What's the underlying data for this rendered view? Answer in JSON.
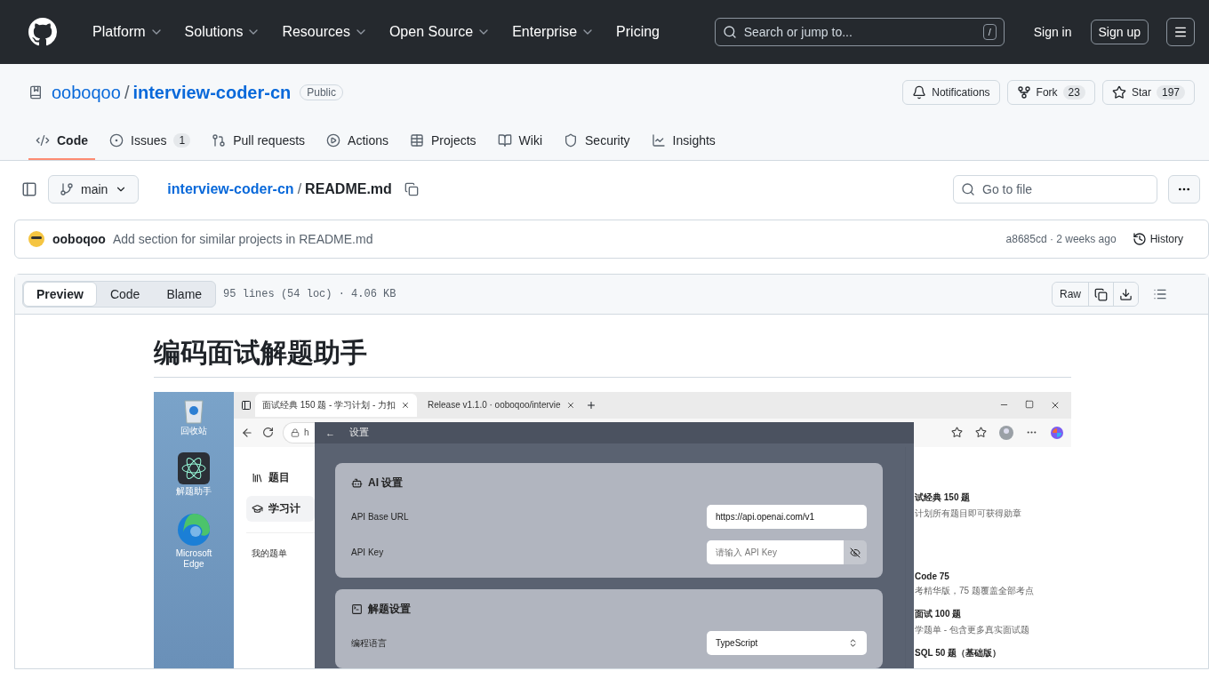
{
  "header": {
    "nav": [
      {
        "label": "Platform",
        "has_menu": true
      },
      {
        "label": "Solutions",
        "has_menu": true
      },
      {
        "label": "Resources",
        "has_menu": true
      },
      {
        "label": "Open Source",
        "has_menu": true
      },
      {
        "label": "Enterprise",
        "has_menu": true
      },
      {
        "label": "Pricing",
        "has_menu": false
      }
    ],
    "search": {
      "placeholder": "Search or jump to...",
      "shortcut": "/"
    },
    "sign_in": "Sign in",
    "sign_up": "Sign up"
  },
  "repo": {
    "owner": "ooboqoo",
    "separator": "/",
    "name": "interview-coder-cn",
    "visibility": "Public",
    "actions": [
      {
        "label": "Notifications"
      },
      {
        "label": "Fork",
        "count": "23"
      },
      {
        "label": "Star",
        "count": "197"
      }
    ]
  },
  "tabs": [
    {
      "label": "Code",
      "selected": true
    },
    {
      "label": "Issues",
      "count": "1",
      "selected": false
    },
    {
      "label": "Pull requests",
      "selected": false
    },
    {
      "label": "Actions",
      "selected": false
    },
    {
      "label": "Projects",
      "selected": false
    },
    {
      "label": "Wiki",
      "selected": false
    },
    {
      "label": "Security",
      "selected": false
    },
    {
      "label": "Insights",
      "selected": false
    }
  ],
  "file_bar": {
    "branch": "main",
    "repo_link": "interview-coder-cn",
    "separator": "/",
    "file": "README.md",
    "search": {
      "placeholder": "Go to file"
    }
  },
  "commit": {
    "author": "ooboqoo",
    "message": "Add section for similar projects in README.md",
    "sha": "a8685cd",
    "separator": "·",
    "time": "2 weeks ago",
    "history": "History"
  },
  "viewer": {
    "modes": [
      {
        "label": "Preview",
        "selected": true
      },
      {
        "label": "Code",
        "selected": false
      },
      {
        "label": "Blame",
        "selected": false
      }
    ],
    "info": "95 lines (54 loc) · 4.06 KB",
    "raw": "Raw"
  },
  "readme": {
    "title": "编码面试解题助手",
    "screenshot": {
      "desktop_icons": [
        "回收站",
        "解题助手",
        "Microsoft Edge"
      ],
      "browser_tabs": [
        {
          "title": "面试经典 150 题 - 学习计划 - 力扣",
          "selected": true
        },
        {
          "title": "Release v1.1.0 · ooboqoo/intervie",
          "selected": false
        }
      ],
      "address": "h",
      "sidebar": [
        {
          "label": "题目",
          "selected": false
        },
        {
          "label": "学习计",
          "selected": true
        }
      ],
      "my_lists": "我的题单",
      "settings": {
        "back": "←",
        "title": "设置",
        "sections": [
          {
            "title": "AI 设置",
            "fields": [
              {
                "label": "API Base URL",
                "kind": "text",
                "value": "https://api.openai.com/v1"
              },
              {
                "label": "API Key",
                "kind": "password",
                "placeholder": "请输入 API Key"
              }
            ]
          },
          {
            "title": "解题设置",
            "fields": [
              {
                "label": "编程语言",
                "kind": "select",
                "value": "TypeScript"
              }
            ]
          }
        ]
      },
      "plans": [
        {
          "title": "试经典 150 题",
          "subtitle": "计划所有题目即可获得勋章"
        },
        {
          "title": "Code 75",
          "subtitle": "考精华版，75 题覆盖全部考点"
        },
        {
          "title": "面试 100 题",
          "subtitle": "学题单 - 包含更多真实面试题"
        },
        {
          "title": "SQL 50 题（基础版）"
        }
      ]
    }
  }
}
